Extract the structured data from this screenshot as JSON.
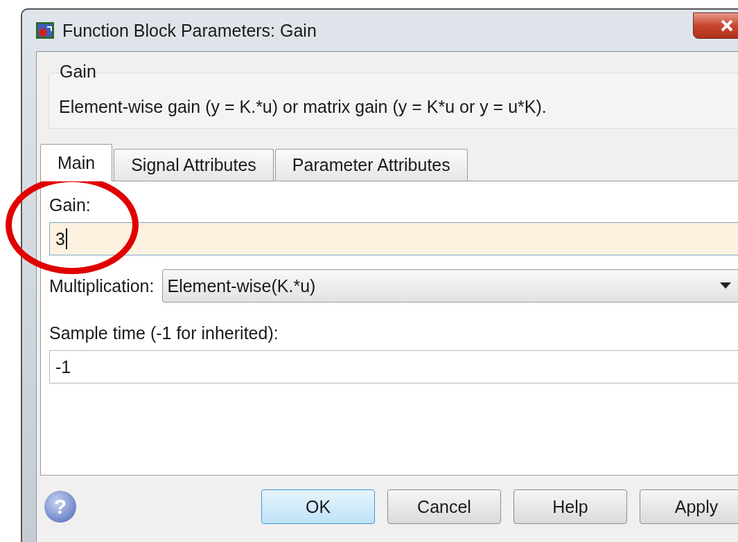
{
  "window": {
    "title": "Function Block Parameters: Gain"
  },
  "group": {
    "title": "Gain",
    "description": "Element-wise gain (y = K.*u) or matrix gain (y = K*u or y = u*K)."
  },
  "tabs": [
    {
      "label": "Main",
      "selected": true
    },
    {
      "label": "Signal Attributes",
      "selected": false
    },
    {
      "label": "Parameter Attributes",
      "selected": false
    }
  ],
  "fields": [
    {
      "kind": "text",
      "label": "Gain:",
      "value": "3",
      "focused": true
    },
    {
      "kind": "dropdown",
      "label": "Multiplication:",
      "value": "Element-wise(K.*u)"
    },
    {
      "kind": "text",
      "label": "Sample time (-1 for inherited):",
      "value": "-1",
      "focused": false
    }
  ],
  "help_glyph": "?",
  "buttons": [
    {
      "label": "OK",
      "default": true
    },
    {
      "label": "Cancel",
      "default": false
    },
    {
      "label": "Help",
      "default": false
    },
    {
      "label": "Apply",
      "default": false
    }
  ],
  "annotation": {
    "kind": "circle"
  }
}
